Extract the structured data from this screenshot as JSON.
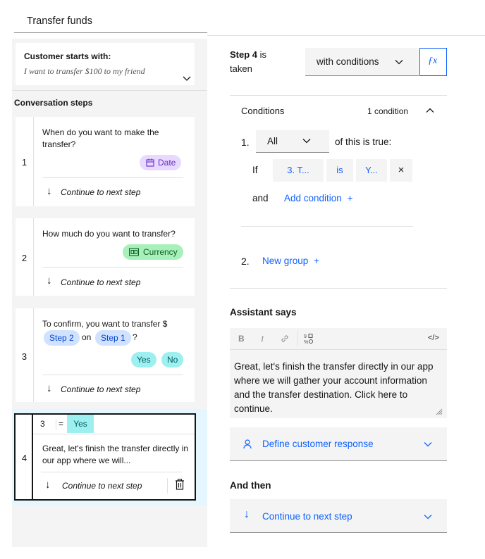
{
  "header": {
    "title": "Transfer funds"
  },
  "customer_start": {
    "label": "Customer starts with:",
    "example": "I want to transfer $100 to my friend"
  },
  "steps_heading": "Conversation steps",
  "steps": [
    {
      "number": "1",
      "text": "When do you want to make the transfer?",
      "tag": "Date",
      "continue": "Continue to next step"
    },
    {
      "number": "2",
      "text": "How much do you want to transfer?",
      "tag": "Currency",
      "continue": "Continue to next step"
    },
    {
      "number": "3",
      "text_prefix": "To confirm, you want to transfer $",
      "ref_a": "Step 2",
      "on": "on",
      "ref_b": "Step 1",
      "qmark": "?",
      "yes": "Yes",
      "no": "No",
      "continue": "Continue to next step"
    },
    {
      "number": "4",
      "cond_step": "3",
      "cond_op": "=",
      "cond_val": "Yes",
      "text": "Great, let's finish the transfer directly in our app where we will...",
      "continue": "Continue to next step"
    }
  ],
  "step_config": {
    "step_word": "Step",
    "step_number": "4",
    "is_word": "is",
    "taken_word": "taken",
    "taken_mode": "with conditions",
    "fx_label": "ƒx"
  },
  "conditions": {
    "title": "Conditions",
    "count_label": "1 condition",
    "group1_index": "1.",
    "match_mode": "All",
    "of_this": "of this is true:",
    "if_label": "If",
    "cond_subject": "3. T...",
    "cond_op": "is",
    "cond_value": "Y...",
    "remove": "×",
    "and_label": "and",
    "add_condition": "Add condition",
    "plus": "+",
    "group2_index": "2.",
    "new_group": "New group"
  },
  "assistant": {
    "heading": "Assistant says",
    "toolbar": {
      "bold": "B",
      "italic": "I",
      "code": "</>"
    },
    "message": "Great, let's finish the transfer directly in our app where we will gather your account information and the transfer destination. Click here to continue."
  },
  "define_response": "Define customer response",
  "and_then": {
    "heading": "And then",
    "value": "Continue to next step"
  },
  "colors": {
    "accent": "#0f62fe",
    "date_tag": "#e8daff",
    "currency_tag": "#a7f0ba",
    "ref_tag": "#d0e2ff",
    "yes_no_tag": "#9ef0f0"
  }
}
